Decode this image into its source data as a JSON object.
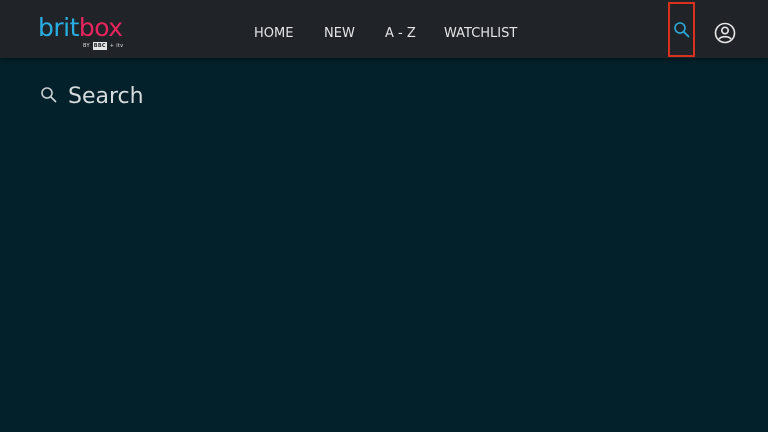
{
  "brand": {
    "word_brit": "brit",
    "word_box": "box",
    "sub_by": "BY",
    "sub_bbc": "BBC",
    "sub_plus": "+",
    "sub_itv": "itv",
    "colors": {
      "brit": "#29aee4",
      "box": "#e8245e"
    }
  },
  "nav": {
    "items": [
      {
        "label": "HOME"
      },
      {
        "label": "NEW"
      },
      {
        "label": "A - Z"
      },
      {
        "label": "WATCHLIST"
      }
    ]
  },
  "header": {
    "search_icon": "search-icon",
    "account_icon": "user-icon",
    "highlight_color": "#d8321f"
  },
  "search": {
    "placeholder": "Search",
    "value": "",
    "icon": "search-icon"
  }
}
